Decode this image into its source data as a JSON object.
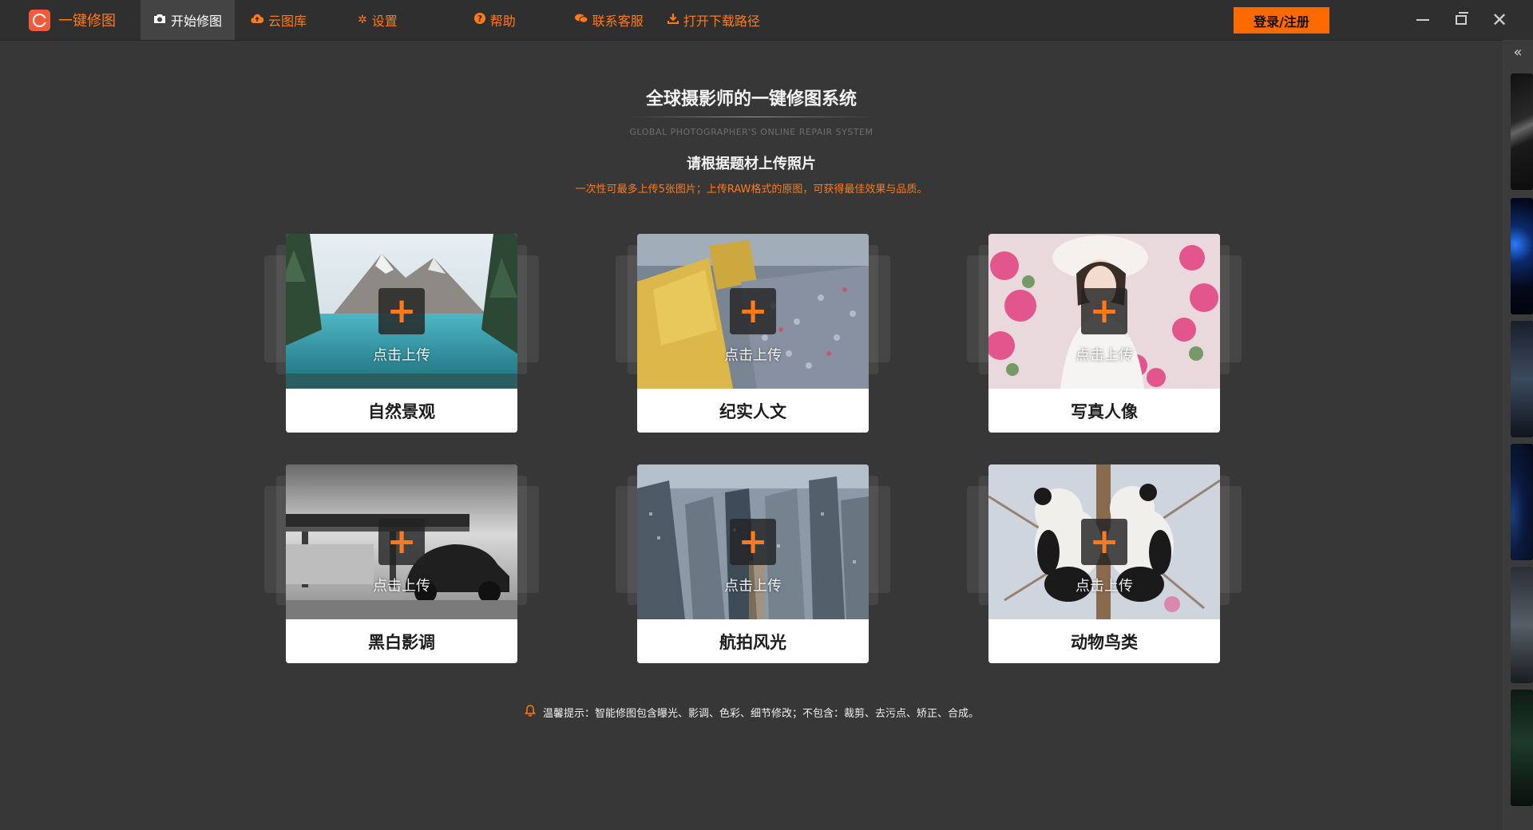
{
  "brand": {
    "name": "一键修图",
    "logo_color": "#f25b3a",
    "accent": "#ff7a1a"
  },
  "nav": [
    {
      "label": "开始修图",
      "icon": "camera-icon",
      "active": true
    },
    {
      "label": "云图库",
      "icon": "cloud-icon",
      "active": false
    },
    {
      "label": "设置",
      "icon": "gear-icon",
      "active": false
    },
    {
      "label": "帮助",
      "icon": "help-icon",
      "active": false
    },
    {
      "label": "联系客服",
      "icon": "chat-icon",
      "active": false
    },
    {
      "label": "打开下载路径",
      "icon": "download-icon",
      "active": false
    }
  ],
  "login_label": "登录/注册",
  "header": {
    "title": "全球摄影师的一键修图系统",
    "subtitle": "GLOBAL PHOTOGRAPHER'S ONLINE REPAIR SYSTEM",
    "heading": "请根据题材上传照片",
    "hint": "一次性可最多上传5张图片；上传RAW格式的原图，可获得最佳效果与品质。"
  },
  "cards": [
    {
      "label": "自然景观",
      "upload": "点击上传"
    },
    {
      "label": "纪实人文",
      "upload": "点击上传"
    },
    {
      "label": "写真人像",
      "upload": "点击上传"
    },
    {
      "label": "黑白影调",
      "upload": "点击上传"
    },
    {
      "label": "航拍风光",
      "upload": "点击上传"
    },
    {
      "label": "动物鸟类",
      "upload": "点击上传"
    }
  ],
  "tip": "温馨提示：智能修图包含曝光、影调、色彩、细节修改；不包含：裁剪、去污点、矫正、合成。"
}
